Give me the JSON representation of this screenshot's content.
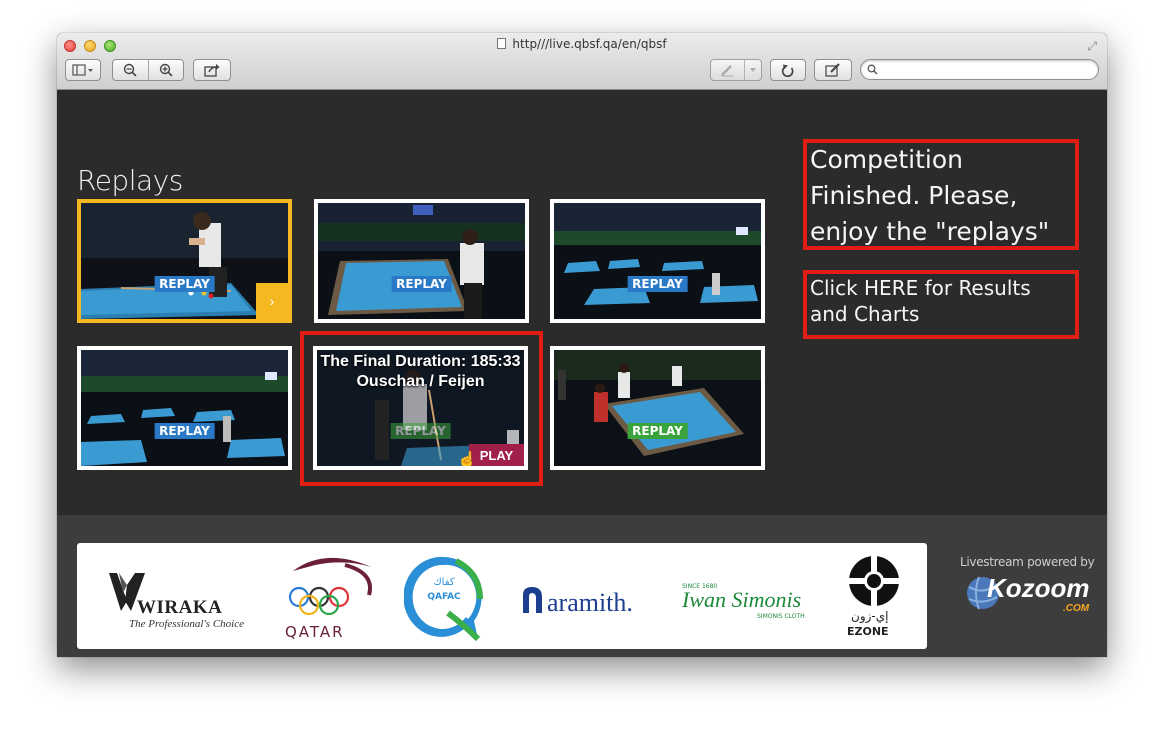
{
  "browser": {
    "url": "http///live.qbsf.qa/en/qbsf",
    "search_placeholder": ""
  },
  "toolbar": {
    "sidebar_icon": "sidebar-icon",
    "zoom_out_icon": "zoom-out-icon",
    "zoom_in_icon": "zoom-in-icon",
    "share_icon": "share-icon",
    "highlight_icon": "highlight-icon",
    "reload_icon": "reload-icon",
    "edit_icon": "edit-icon"
  },
  "page": {
    "section_title": "Replays",
    "thumbnails": [
      {
        "badge": "REPLAY",
        "active": true
      },
      {
        "badge": "REPLAY"
      },
      {
        "badge": "REPLAY"
      },
      {
        "badge": "REPLAY"
      },
      {
        "badge": "REPLAY",
        "overlay_title": "The Final Duration: 185:33 Ouschan / Feijen",
        "play_label": "PLAY"
      },
      {
        "badge": "REPLAY"
      }
    ],
    "notice": "Competition Finished. Please, enjoy the \"replays\"",
    "results_link": "Click HERE for Results and Charts"
  },
  "footer": {
    "sponsors": {
      "wiraka": "WIRAKA",
      "wiraka_tagline": "The Professional's Choice",
      "qatar": "QATAR",
      "qafac": "QAFAC",
      "qafac_arabic": "كفاك",
      "aramith": "aramith.",
      "simonis": "Iwan Simonis",
      "simonis_since": "SINCE 1680",
      "simonis_sub": "SIMONIS CLOTH",
      "ezone": "EZONE",
      "ezone_arabic": "إي-زون"
    },
    "powered_by": "Livestream powered by",
    "kozoom": "Kozoom",
    "kozoom_com": ".COM"
  },
  "colors": {
    "accent_yellow": "#f5b820",
    "highlight_red": "#e01e16",
    "replay_blue": "#2a79c7",
    "replay_green": "#3ba33b",
    "play_magenta": "#a0204a",
    "page_bg": "#2b2b2b",
    "footer_bg": "#3d3d3d"
  }
}
